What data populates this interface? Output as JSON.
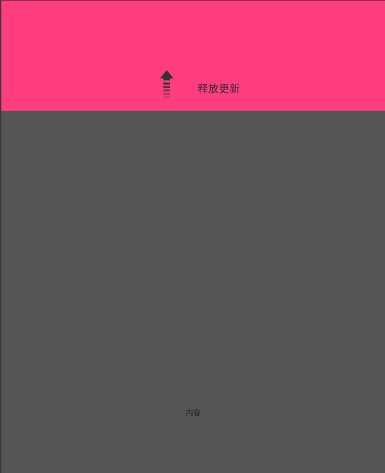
{
  "colors": {
    "header_background": "#FF3D7F",
    "content_background": "#555555",
    "arrow": "#333333"
  },
  "header": {
    "icon": "arrow-up-icon",
    "refresh_text": "释放更新"
  },
  "content": {
    "label": "内容"
  }
}
